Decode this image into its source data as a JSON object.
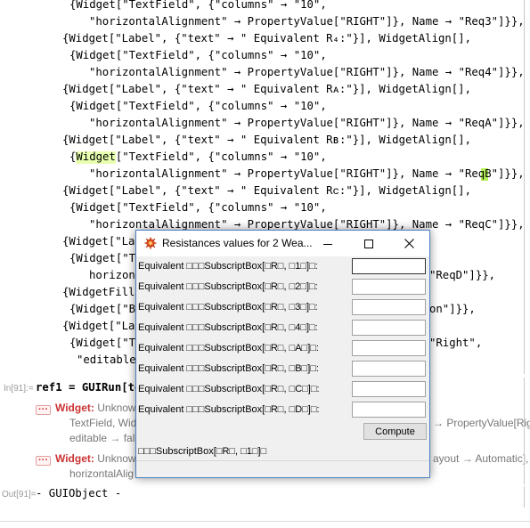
{
  "notebook": {
    "code_lines": [
      "{Widget[\"TextField\", {\"columns\" → \"10\",",
      "\"horizontalAlignment\" → PropertyValue[\"RIGHT\"]}, Name → \"Req3\"]}},",
      "{Widget[\"Label\", {\"text\" → \" Equivalent R₄:\"}], WidgetAlign[],",
      "{Widget[\"TextField\", {\"columns\" → \"10\",",
      "\"horizontalAlignment\" → PropertyValue[\"RIGHT\"]}, Name → \"Req4\"]}},",
      "{Widget[\"Label\", {\"text\" → \" Equivalent Rᴀ:\"}], WidgetAlign[],",
      "{Widget[\"TextField\", {\"columns\" → \"10\",",
      "\"horizontalAlignment\" → PropertyValue[\"RIGHT\"]}, Name → \"ReqA\"]}},",
      "{Widget[\"Label\", {\"text\" → \" Equivalent Rʙ:\"}], WidgetAlign[],",
      "{Widget[\"TextField\", {\"columns\" → \"10\",",
      "\"horizontalAlignment\" → PropertyValue[\"RIGHT\"]}, Name → \"ReqB\"]}},",
      "{Widget[\"Label\", {\"text\" → \" Equivalent Rᴄ:\"}], WidgetAlign[],",
      "{Widget[\"TextField\", {\"columns\" → \"10\",",
      "\"horizontalAlignment\" → PropertyValue[\"RIGHT\"]}, Name → \"ReqC\"]}},",
      "{Widget[\"Lab",
      "{Widget[\"Te",
      "horizon",
      "\"ReqD\"]}},",
      "{WidgetFill",
      "{Widget[\"Bu",
      "on\"]}},",
      "{Widget[\"Lab",
      "{Widget[\"Tex",
      "\"Right\",",
      "\"editable"
    ],
    "in_label": "In[91]:=",
    "input_line": "ref1 = GUIRun[tes",
    "messages": [
      {
        "head": "Widget:",
        "line1": " Unknow",
        "line2": "TextField, Wid",
        "line3": "editable → fals",
        "right": "→ PropertyValue[Right]"
      },
      {
        "head": "Widget:",
        "line1": " Unknow",
        "line2": "horizontalAlig",
        "right": "ayout → Automatic],"
      }
    ],
    "out_label": "Out[91]=",
    "output_line": "- GUIObject -",
    "msg_icon": "···"
  },
  "dialog": {
    "title": "Resistances values for 2 Wea...",
    "icon": "gear-sun-icon",
    "rows": [
      {
        "label": "Equivalent □□□SubscriptBox[□R□, □1□]□:",
        "value": ""
      },
      {
        "label": "Equivalent □□□SubscriptBox[□R□, □2□]□:",
        "value": ""
      },
      {
        "label": "Equivalent □□□SubscriptBox[□R□, □3□]□:",
        "value": ""
      },
      {
        "label": "Equivalent □□□SubscriptBox[□R□, □4□]□:",
        "value": ""
      },
      {
        "label": "Equivalent □□□SubscriptBox[□R□, □A□]□:",
        "value": ""
      },
      {
        "label": "Equivalent □□□SubscriptBox[□R□, □B□]□:",
        "value": ""
      },
      {
        "label": "Equivalent □□□SubscriptBox[□R□, □C□]□:",
        "value": ""
      },
      {
        "label": "Equivalent □□□SubscriptBox[□R□, □D□]□:",
        "value": ""
      }
    ],
    "compute_label": "Compute",
    "footer_label": "□□□SubscriptBox[□R□, □1□]□",
    "controls": {
      "minimize": "minimize-icon",
      "maximize": "maximize-icon",
      "close": "close-icon"
    }
  }
}
